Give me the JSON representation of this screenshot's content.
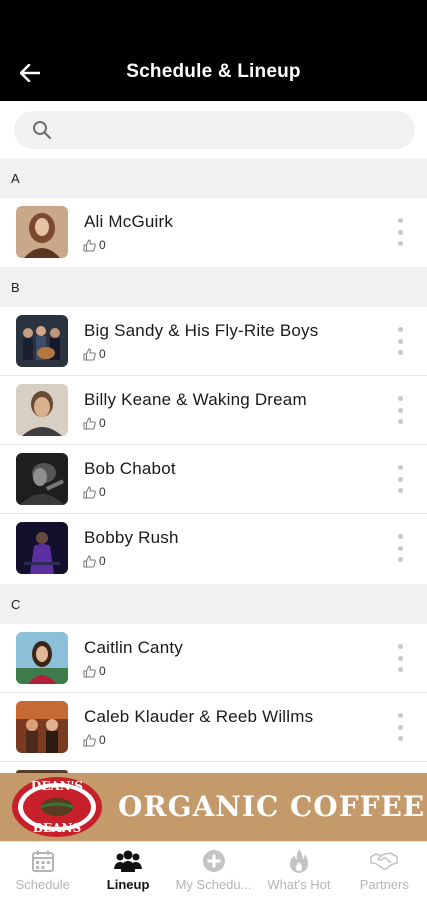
{
  "app_bar": {
    "title": "Schedule & Lineup"
  },
  "search": {
    "placeholder": "",
    "value": ""
  },
  "sections": [
    {
      "letter": "A",
      "artists": [
        {
          "name": "Ali McGuirk",
          "likes": "0"
        }
      ]
    },
    {
      "letter": "B",
      "artists": [
        {
          "name": "Big Sandy & His Fly-Rite Boys",
          "likes": "0"
        },
        {
          "name": "Billy Keane & Waking Dream",
          "likes": "0"
        },
        {
          "name": "Bob Chabot",
          "likes": "0"
        },
        {
          "name": "Bobby Rush",
          "likes": "0"
        }
      ]
    },
    {
      "letter": "C",
      "artists": [
        {
          "name": "Caitlin Canty",
          "likes": "0"
        },
        {
          "name": "Caleb Klauder & Reeb Willms",
          "likes": "0"
        }
      ]
    }
  ],
  "banner": {
    "text": "ORGANIC COFFEE",
    "logo_text_top": "DEAN'S",
    "logo_text_bottom": "BEANS"
  },
  "tabs": [
    {
      "label": "Schedule",
      "icon": "calendar-icon",
      "active": false
    },
    {
      "label": "Lineup",
      "icon": "people-icon",
      "active": true
    },
    {
      "label": "My Schedu...",
      "icon": "plus-circle-icon",
      "active": false
    },
    {
      "label": "What's Hot",
      "icon": "flame-icon",
      "active": false
    },
    {
      "label": "Partners",
      "icon": "handshake-icon",
      "active": false
    }
  ],
  "colors": {
    "app_bar": "#000000",
    "banner": "#c59a6b",
    "section_bg": "#f1f1f1",
    "tab_inactive": "#b5b5b5",
    "tab_active": "#111111"
  }
}
